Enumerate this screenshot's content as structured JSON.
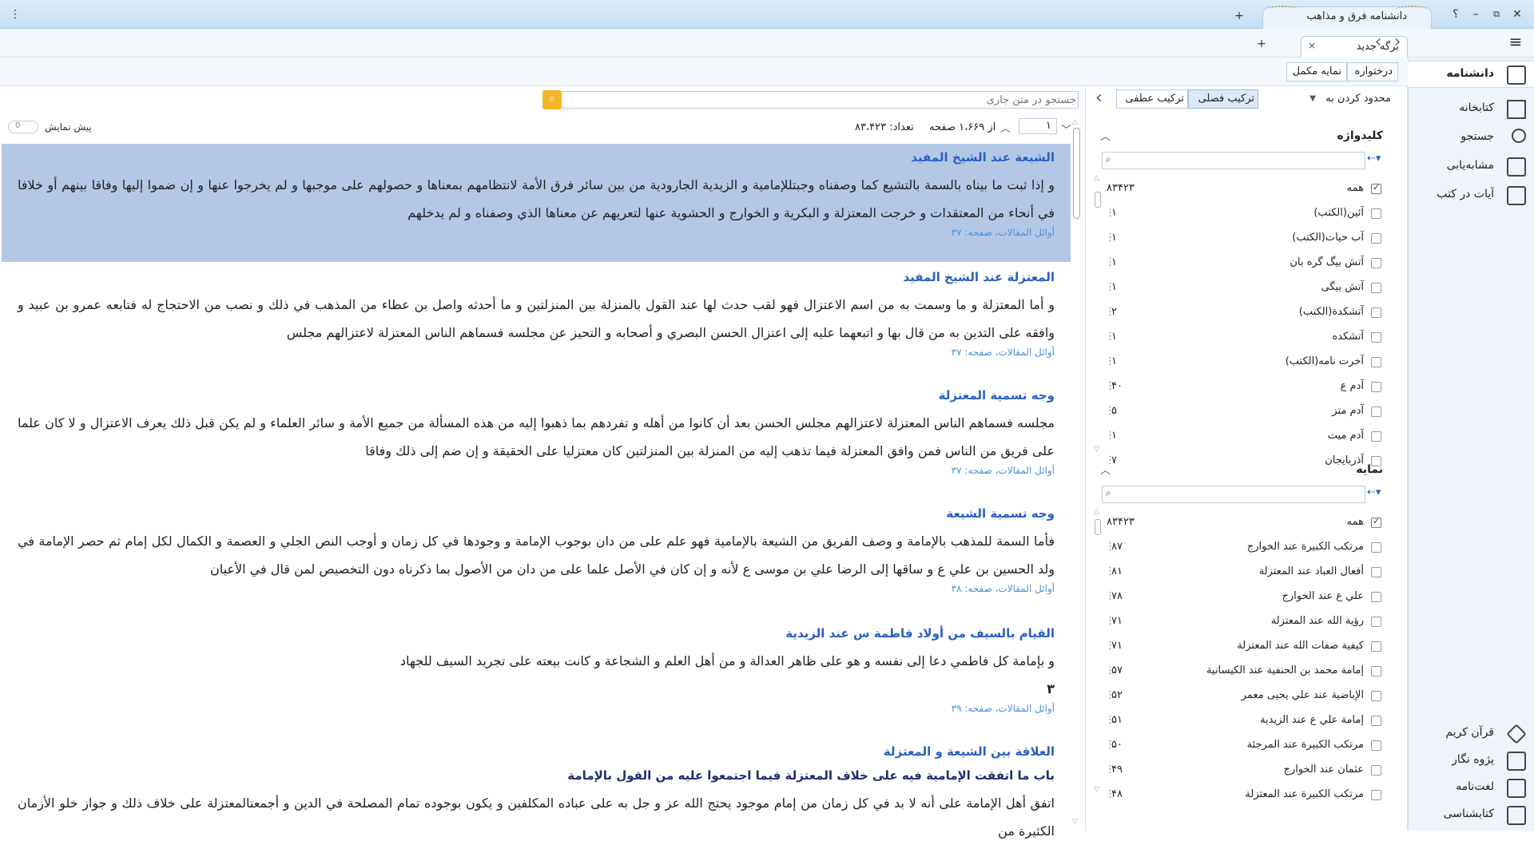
{
  "window": {
    "app_tab_title": "دانشنامه فرق و مذاهب",
    "help": "؟",
    "minimize": "–",
    "restore": "⧉",
    "close": "✕",
    "new_tab": "+",
    "menu": "⋮"
  },
  "tabs": {
    "doc_tab_title": "برگه جدید",
    "close": "×",
    "add": "+",
    "back": "‹",
    "forward": "›",
    "hamburger": "≡"
  },
  "view_toggle": {
    "tree": "درختواره",
    "full_index": "نمایه مکمل"
  },
  "nav": {
    "items": [
      {
        "label": "دانشنامه",
        "icon": "encyclopedia-icon"
      },
      {
        "label": "کتابخانه",
        "icon": "library-icon"
      },
      {
        "label": "جستجو",
        "icon": "search-icon"
      },
      {
        "label": "مشابه‌یابی",
        "icon": "similarity-icon"
      },
      {
        "label": "آیات در کتب",
        "icon": "verses-icon"
      }
    ],
    "bottom_items": [
      {
        "label": "قرآن کریم",
        "icon": "quran-icon"
      },
      {
        "label": "پژوه نگار",
        "icon": "notes-icon"
      },
      {
        "label": "لغت‌نامه",
        "icon": "dictionary-icon"
      },
      {
        "label": "کتابشناسی",
        "icon": "bibliography-icon"
      }
    ]
  },
  "filter": {
    "limit_label": "محدود کردن به",
    "separated_combo": "ترکیب فصلی",
    "joined_combo": "ترکیب عطفی",
    "collapse": "‹"
  },
  "keywords": {
    "title": "کلیدواژه",
    "rows": [
      {
        "label": "همه",
        "count": "۸۳۴۲۳",
        "checked": true
      },
      {
        "label": "آئین(الکتب)",
        "count": "۱"
      },
      {
        "label": "آب حیات(الکتب)",
        "count": "۱"
      },
      {
        "label": "آتش بیگ گره بان",
        "count": "۱"
      },
      {
        "label": "آتش بیگی",
        "count": "۱"
      },
      {
        "label": "آتشکدة(الکتب)",
        "count": "۲"
      },
      {
        "label": "آتشکده",
        "count": "۱"
      },
      {
        "label": "آخرت نامه(الکتب)",
        "count": "۱"
      },
      {
        "label": "آدم ع",
        "count": "۴۰"
      },
      {
        "label": "آدم متز",
        "count": "۵"
      },
      {
        "label": "آدم میت",
        "count": "۱"
      },
      {
        "label": "آذربایجان",
        "count": "۷"
      }
    ]
  },
  "index": {
    "title": "نمایه",
    "rows": [
      {
        "label": "همه",
        "count": "۸۳۴۲۳",
        "checked": true
      },
      {
        "label": "مرتكب الكبيرة عند الخوارج",
        "count": "۸۷"
      },
      {
        "label": "أفعال العباد عند المعتزلة",
        "count": "۸۱"
      },
      {
        "label": "علي ع عند الخوارج",
        "count": "۷۸"
      },
      {
        "label": "رؤية الله عند المعتزلة",
        "count": "۷۱"
      },
      {
        "label": "كيفية صفات الله عند المعتزلة",
        "count": "۷۱"
      },
      {
        "label": "إمامة محمد بن الحنفية عند الكيسانية",
        "count": "۵۷"
      },
      {
        "label": "الإباضية عند علي يحيى معمر",
        "count": "۵۲"
      },
      {
        "label": "إمامة علي ع عند الزيدية",
        "count": "۵۱"
      },
      {
        "label": "مرتكب الكبيرة عند المرجئة",
        "count": "۵۰"
      },
      {
        "label": "عثمان عند الخوارج",
        "count": "۴۹"
      },
      {
        "label": "مرتكب الكبيرة عند المعتزلة",
        "count": "۴۸"
      }
    ]
  },
  "search": {
    "placeholder": "جستجو در متن جاری"
  },
  "pager": {
    "page": "۱",
    "of_pages": "از ۱،۶۶۹ صفحه",
    "count_label": "تعداد: ۸۳،۴۲۳",
    "preview_label": "پیش نمایش",
    "preview_value": "0"
  },
  "results": [
    {
      "title": "الشيعة عند الشيخ المفيد",
      "body": "و إذا ثبت ما بيناه بالسمة بالتشيع كما وصفناه وجبتللإمامية و الزيدية الجارودية من بين سائر فرق الأمة لانتظامهم بمعناها و حصولهم على موجبها و لم يخرجوا عنها و إن ضموا إليها وفاقا بينهم أو خلافا في أنحاء من المعتقدات و خرجت المعتزلة و البكرية و الخوارج و الحشوية عنها لتعريهم عن معناها الذي وصفناه و لم يدخلهم",
      "source": "أوائل المقالات، صفحه: ۳۷"
    },
    {
      "title": "المعتزلة عند الشيخ المفيد",
      "body": "و أما المعتزلة و ما وسمت به من اسم الاعتزال فهو لقب حدث لها عند القول بالمنزلة بين المنزلتين و ما أحدثه واصل بن عطاء من المذهب في ذلك و نصب من الاحتجاج له فتابعه عمرو بن عبيد و وافقه على التدين به من قال بها و اتبعهما عليه إلى اعتزال الحسن البصري و أصحابه و التحيز عن مجلسه فسماهم الناس المعتزلة لاعتزالهم مجلس",
      "source": "أوائل المقالات، صفحه: ۳۷"
    },
    {
      "title": "وجه تسمية المعتزلة",
      "body": "مجلسه فسماهم الناس المعتزلة لاعتزالهم مجلس الحسن بعد أن كانوا من أهله و تفردهم بما ذهبوا إليه من هذه المسألة من جميع الأمة و سائر العلماء و لم يكن قبل ذلك يعرف الاعتزال و لا كان علما على فريق من الناس فمن وافق المعتزلة فيما تذهب إليه من المنزلة بين المنزلتين كان معتزليا على الحقيقة و إن ضم إلى ذلك وفاقا",
      "source": "أوائل المقالات، صفحه: ۳۷"
    },
    {
      "title": "وجه تسمية الشيعة",
      "body": "فأما السمة للمذهب بالإمامة و وصف الفريق من الشيعة بالإمامية فهو علم على من دان بوجوب الإمامة و وجودها في كل زمان و أوجب النص الجلي و العصمة و الكمال لكل إمام ثم حصر الإمامة في ولد الحسين بن علي ع و ساقها إلى الرضا علي بن موسى ع لأنه و إن كان في الأصل علما على من دان من الأصول بما ذكرناه دون التخصيص لمن قال في الأعيان",
      "source": "أوائل المقالات، صفحه: ۳۸"
    },
    {
      "title": "القيام بالسيف من أولاد فاطمة س عند الزيدية",
      "body": "و بإمامة كل فاطمي دعا إلى نفسه و هو على ظاهر العدالة و من أهل العلم و الشجاعة و كانت بيعته على تجريد السيف للجهاد",
      "body2": "۳",
      "source": "أوائل المقالات، صفحه: ۳۹"
    },
    {
      "title": "العلاقة بين الشيعة و المعتزلة",
      "subtitle": "باب ما اتفقت الإمامية فيه على خلاف المعتزلة فيما اجتمعوا عليه من القول بالإمامة",
      "body": "اتفق أهل الإمامة على أنه لا بد في كل زمان من إمام موجود يحتج الله عز و جل به على عباده المكلفين و يكون بوجوده تمام المصلحة في الدين و أجمعتالمعتزلة على خلاف ذلك و جواز خلو الأزمان الكثيرة من"
    }
  ]
}
